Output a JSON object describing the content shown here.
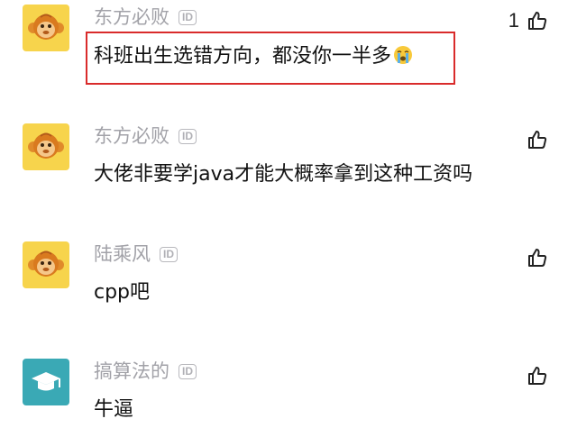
{
  "comments": [
    {
      "username": "东方必败",
      "id_badge": "ID",
      "content": "科班出生选错方向，都没你一半多",
      "emoji": "crying-face-emoji",
      "likes": "1",
      "avatar": "monkey-avatar"
    },
    {
      "username": "东方必败",
      "id_badge": "ID",
      "content": "大佬非要学java才能大概率拿到这种工资吗",
      "likes": "",
      "avatar": "monkey-avatar"
    },
    {
      "username": "陆乘风",
      "id_badge": "ID",
      "content": "cpp吧",
      "likes": "",
      "avatar": "monkey-avatar"
    },
    {
      "username": "搞算法的",
      "id_badge": "ID",
      "content": "牛逼",
      "likes": "",
      "avatar": "graduation-cap-avatar"
    }
  ],
  "colors": {
    "monkey_bg": "#f7d44c",
    "cap_bg": "#3aa9b5",
    "highlight_border": "#d92b2b",
    "username": "#a2a2a8"
  }
}
